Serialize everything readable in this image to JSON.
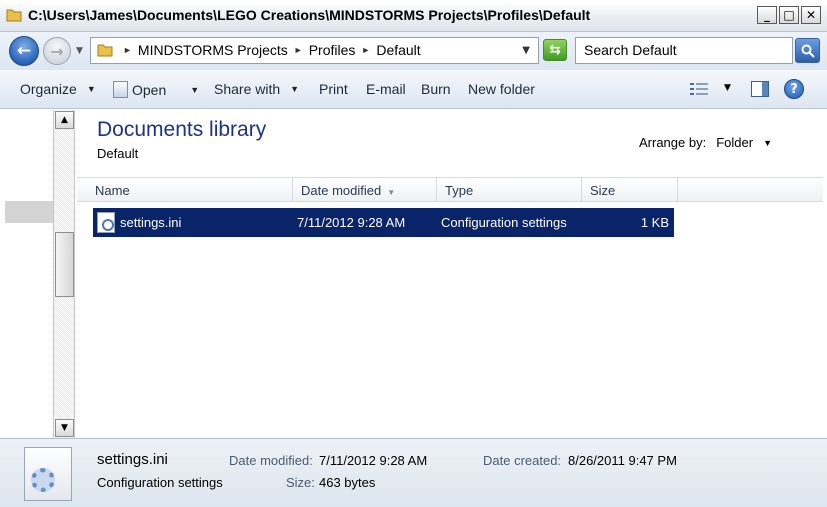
{
  "window": {
    "title": "C:\\Users\\James\\Documents\\LEGO Creations\\MINDSTORMS Projects\\Profiles\\Default",
    "buttons": {
      "minimize": "_",
      "maximize": "□",
      "close": "✕"
    }
  },
  "address": {
    "crumbs": [
      "MINDSTORMS Projects",
      "Profiles",
      "Default"
    ],
    "search_placeholder": "Search Default"
  },
  "toolbar": {
    "organize": "Organize",
    "open": "Open",
    "share_with": "Share with",
    "print": "Print",
    "email": "E-mail",
    "burn": "Burn",
    "new_folder": "New folder"
  },
  "library": {
    "title": "Documents library",
    "subtitle": "Default",
    "arrange_label": "Arrange by:",
    "arrange_value": "Folder"
  },
  "columns": {
    "name": "Name",
    "date_modified": "Date modified",
    "type": "Type",
    "size": "Size"
  },
  "files": [
    {
      "name": "settings.ini",
      "date_modified": "7/11/2012 9:28 AM",
      "type": "Configuration settings",
      "size": "1 KB"
    }
  ],
  "details": {
    "name": "settings.ini",
    "type": "Configuration settings",
    "date_modified_label": "Date modified:",
    "date_modified": "7/11/2012 9:28 AM",
    "size_label": "Size:",
    "size": "463 bytes",
    "date_created_label": "Date created:",
    "date_created": "8/26/2011 9:47 PM"
  },
  "colors": {
    "selection": "#0a246a",
    "library_title": "#1e3287",
    "toolbar_bg": "#dde6f1"
  }
}
